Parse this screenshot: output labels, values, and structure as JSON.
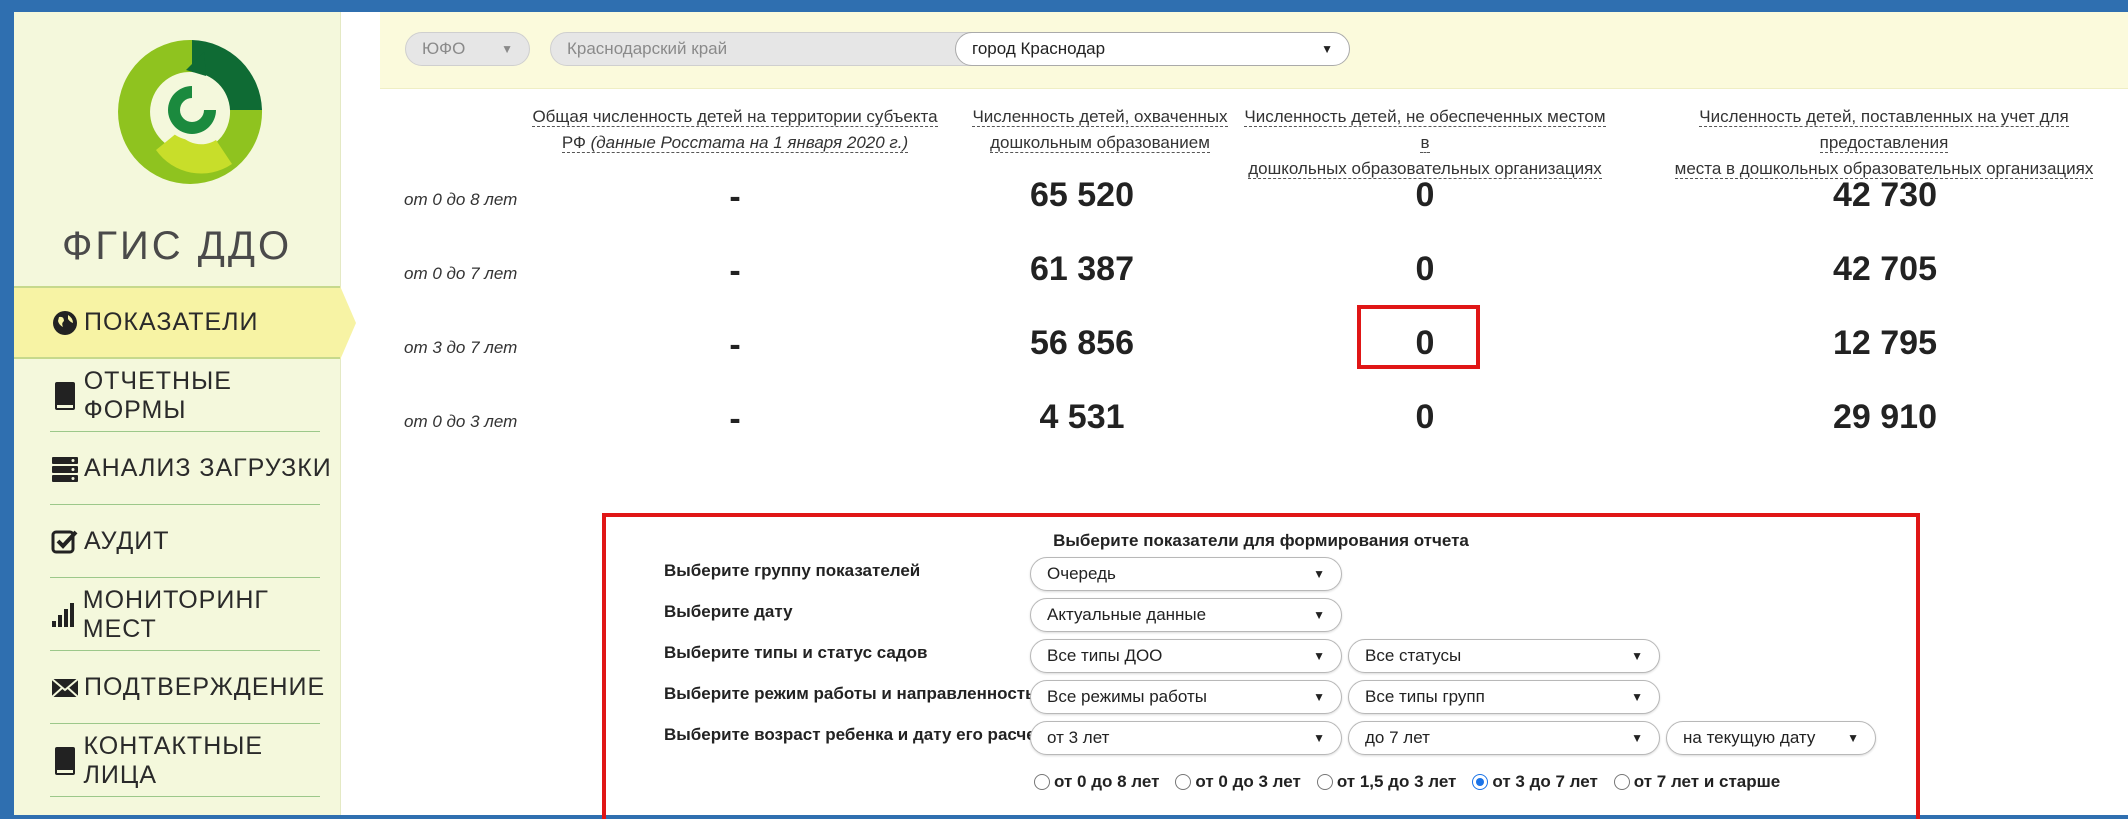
{
  "sidebar": {
    "brand": "ФГИС ДДО",
    "items": [
      {
        "label": "ПОКАЗАТЕЛИ",
        "icon": "globe-icon",
        "active": true
      },
      {
        "label": "ОТЧЕТНЫЕ ФОРМЫ",
        "icon": "book-icon",
        "active": false
      },
      {
        "label": "АНАЛИЗ ЗАГРУЗКИ",
        "icon": "server-icon",
        "active": false
      },
      {
        "label": "АУДИТ",
        "icon": "checkbox-icon",
        "active": false
      },
      {
        "label": "МОНИТОРИНГ МЕСТ",
        "icon": "bar-chart-icon",
        "active": false
      },
      {
        "label": "ПОДТВЕРЖДЕНИЕ",
        "icon": "envelope-icon",
        "active": false
      },
      {
        "label": "КОНТАКТНЫЕ ЛИЦА",
        "icon": "book-icon",
        "active": false
      }
    ]
  },
  "filters": {
    "district": "ЮФО",
    "region": "Краснодарский край",
    "city": "город Краснодар"
  },
  "indicators": {
    "columns": [
      "Общая численность детей на территории субъекта РФ (данные Росстата на 1 января 2020 г.)",
      "Численность детей, охваченных дошкольным образованием",
      "Численность детей, не обеспеченных местом в дошкольных образовательных организациях",
      "Численность детей, поставленных на учет для предоставления места в дошкольных образовательных организациях"
    ],
    "col1_line1": "Общая численность детей на территории субъекта",
    "col1_line2_prefix": "РФ ",
    "col1_line2_italic": "(данные Росстата на 1 января 2020 г.)",
    "col2_line1": "Численность детей, охваченных",
    "col2_line2": "дошкольным образованием",
    "col3_line1": "Численность детей, не обеспеченных местом в",
    "col3_line2": "дошкольных образовательных организациях",
    "col4_line1": "Численность детей, поставленных на учет для предоставления",
    "col4_line2": "места в дошкольных образовательных организациях",
    "rows": [
      {
        "label": "от 0 до 8 лет",
        "total": "-",
        "covered": "65 520",
        "unprovided": "0",
        "registered": "42 730"
      },
      {
        "label": "от 0 до 7 лет",
        "total": "-",
        "covered": "61 387",
        "unprovided": "0",
        "registered": "42 705"
      },
      {
        "label": "от 3 до 7 лет",
        "total": "-",
        "covered": "56 856",
        "unprovided": "0",
        "registered": "12 795"
      },
      {
        "label": "от 0 до 3 лет",
        "total": "-",
        "covered": "4 531",
        "unprovided": "0",
        "registered": "29 910"
      }
    ]
  },
  "report": {
    "title": "Выберите показатели для формирования отчета",
    "labels": {
      "group": "Выберите группу показателей",
      "date": "Выберите дату",
      "types": "Выберите типы и статус садов",
      "mode": "Выберите режим работы и направленность",
      "age": "Выберите возраст ребенка и дату его расчета"
    },
    "selects": {
      "group": "Очередь",
      "date": "Актуальные данные",
      "types": "Все типы ДОО",
      "status": "Все статусы",
      "mode": "Все режимы работы",
      "group_types": "Все типы групп",
      "age_from": "от 3 лет",
      "age_to": "до 7 лет",
      "calc_date": "на текущую дату"
    },
    "radios": [
      {
        "label": "от 0 до 8 лет",
        "checked": false
      },
      {
        "label": "от 0 до 3 лет",
        "checked": false
      },
      {
        "label": "от 1,5 до 3 лет",
        "checked": false
      },
      {
        "label": "от 3 до 7 лет",
        "checked": true
      },
      {
        "label": "от 7 лет и старше",
        "checked": false
      }
    ]
  },
  "colors": {
    "highlight": "#e01616",
    "sidebar_bg": "#f4f8dc",
    "active_item": "#f7f3a4",
    "frame": "#2f6fb0"
  }
}
